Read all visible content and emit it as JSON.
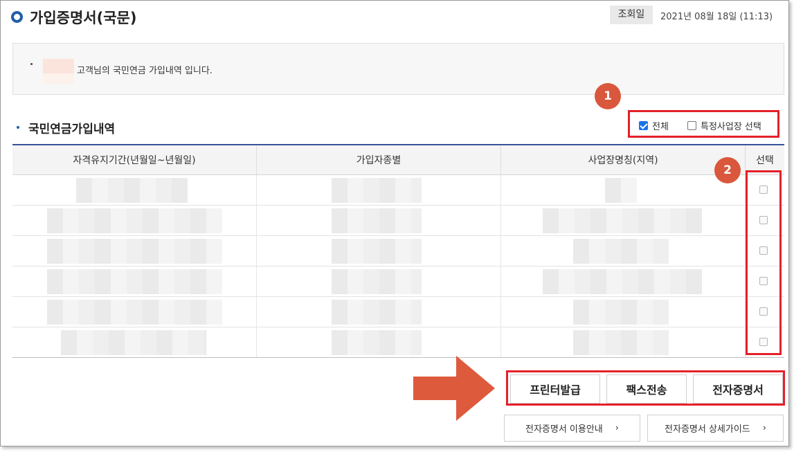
{
  "header": {
    "title": "가입증명서(국문)",
    "date_label": "조회일",
    "date_value": "2021년 08월 18일 (11:13)"
  },
  "notice": {
    "text": "고객님의 국민연금 가입내역 입니다."
  },
  "section": {
    "title": "국민연금가입내역"
  },
  "options": {
    "all_label": "전체",
    "all_checked": true,
    "specific_label": "특정사업장 선택",
    "specific_checked": false
  },
  "badges": [
    "1",
    "2"
  ],
  "table": {
    "columns": [
      "자격유지기간(년월일~년월일)",
      "가입자종별",
      "사업장명칭(지역)",
      "선택"
    ],
    "row_count": 6
  },
  "actions": {
    "print": "프린터발급",
    "fax": "팩스전송",
    "ecert": "전자증명서"
  },
  "links": {
    "guide": "전자증명서 이용안내",
    "detail_guide": "전자증명서 상세가이드"
  },
  "colors": {
    "accent_blue": "#1f5fa8",
    "highlight_red": "#e4202a",
    "badge": "#d9573c",
    "arrow": "#dd5a3c"
  }
}
